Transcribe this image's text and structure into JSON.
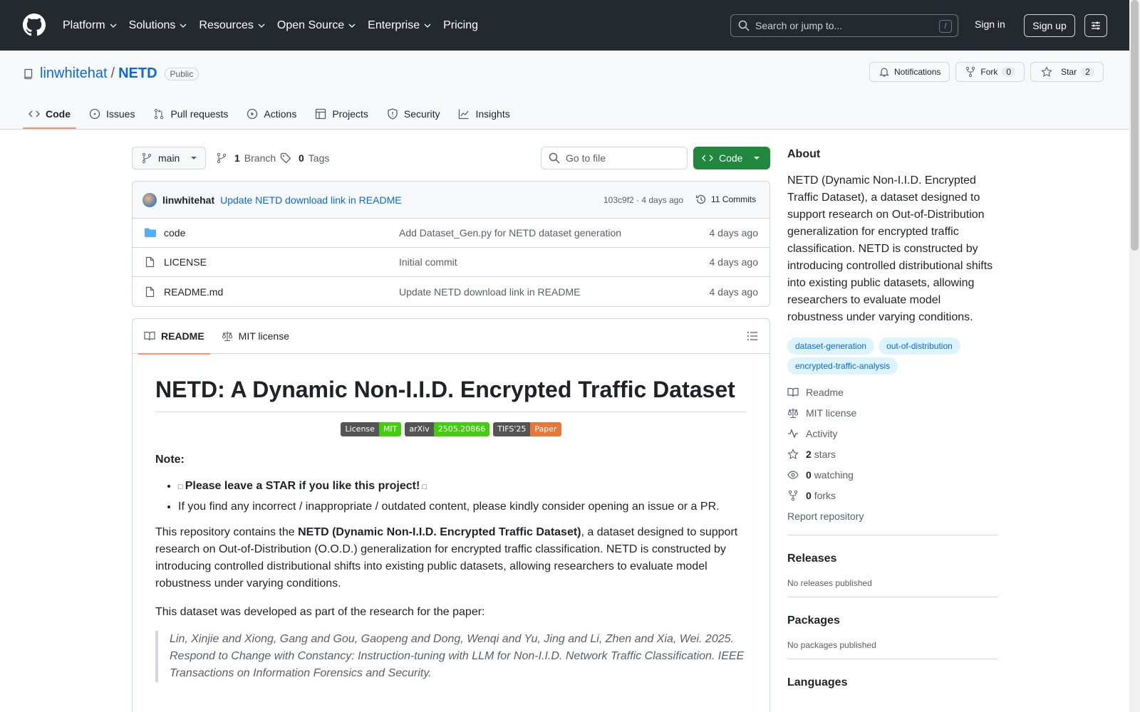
{
  "header": {
    "nav": [
      "Platform",
      "Solutions",
      "Resources",
      "Open Source",
      "Enterprise",
      "Pricing"
    ],
    "search_placeholder": "Search or jump to...",
    "search_shortcut": "/",
    "signin": "Sign in",
    "signup": "Sign up"
  },
  "repo": {
    "owner": "linwhitehat",
    "sep": "/",
    "name": "NETD",
    "visibility": "Public",
    "notifications_label": "Notifications",
    "fork_label": "Fork",
    "fork_count": "0",
    "star_label": "Star",
    "star_count": "2",
    "tabs": [
      "Code",
      "Issues",
      "Pull requests",
      "Actions",
      "Projects",
      "Security",
      "Insights"
    ]
  },
  "toolbar": {
    "branch": "main",
    "branch_count": "1",
    "branch_label": "Branch",
    "tag_count": "0",
    "tag_label": "Tags",
    "gofile_placeholder": "Go to file",
    "code_label": "Code"
  },
  "commit": {
    "author": "linwhitehat",
    "message": "Update NETD download link in README",
    "meta": "103c9f2 · 4 days ago",
    "commits_label": "11 Commits"
  },
  "files": [
    {
      "name": "code",
      "type": "folder",
      "message": "Add Dataset_Gen.py for NETD dataset generation",
      "date": "4 days ago"
    },
    {
      "name": "LICENSE",
      "type": "file",
      "message": "Initial commit",
      "date": "4 days ago"
    },
    {
      "name": "README.md",
      "type": "file",
      "message": "Update NETD download link in README",
      "date": "4 days ago"
    }
  ],
  "readme": {
    "tabs": [
      "README",
      "MIT license"
    ],
    "title": "NETD: A Dynamic Non-I.I.D. Encrypted Traffic Dataset",
    "badges": [
      {
        "left": "License",
        "right": "MIT",
        "color": "#4c1"
      },
      {
        "left": "arXiv",
        "right": "2505.20866",
        "color": "#4c1"
      },
      {
        "left": "TIFS'25",
        "right": "Paper",
        "color": "#e8773a"
      }
    ],
    "note_heading": "Note:",
    "bullet1": "Please leave a STAR if you like this project!",
    "bullet2": "If you find any incorrect / inappropriate / outdated content, please kindly consider opening an issue or a PR.",
    "para1_pre": "This repository contains the ",
    "para1_bold": "NETD (Dynamic Non-I.I.D. Encrypted Traffic Dataset)",
    "para1_post": ", a dataset designed to support research on Out-of-Distribution (O.O.D.) generalization for encrypted traffic classification. NETD is constructed by introducing controlled distributional shifts into existing public datasets, allowing researchers to evaluate model robustness under varying conditions.",
    "para2": "This dataset was developed as part of the research for the paper:",
    "quote": "Lin, Xinjie and Xiong, Gang and Gou, Gaopeng and Dong, Wenqi and Yu, Jing and Li, Zhen and Xia, Wei. 2025. Respond to Change with Constancy: Instruction-tuning with LLM for Non-I.I.D. Network Traffic Classification. IEEE Transactions on Information Forensics and Security."
  },
  "about": {
    "heading": "About",
    "description": "NETD (Dynamic Non-I.I.D. Encrypted Traffic Dataset), a dataset designed to support research on Out-of-Distribution generalization for encrypted traffic classification. NETD is constructed by introducing controlled distributional shifts into existing public datasets, allowing researchers to evaluate model robustness under varying conditions.",
    "topics": [
      "dataset-generation",
      "out-of-distribution",
      "encrypted-traffic-analysis"
    ],
    "links": {
      "readme": "Readme",
      "license": "MIT license",
      "activity": "Activity",
      "stars_count": "2",
      "stars_label": "stars",
      "watching_count": "0",
      "watching_label": "watching",
      "forks_count": "0",
      "forks_label": "forks",
      "report": "Report repository"
    }
  },
  "releases": {
    "heading": "Releases",
    "empty": "No releases published"
  },
  "packages": {
    "heading": "Packages",
    "empty": "No packages published"
  },
  "languages": {
    "heading": "Languages"
  }
}
